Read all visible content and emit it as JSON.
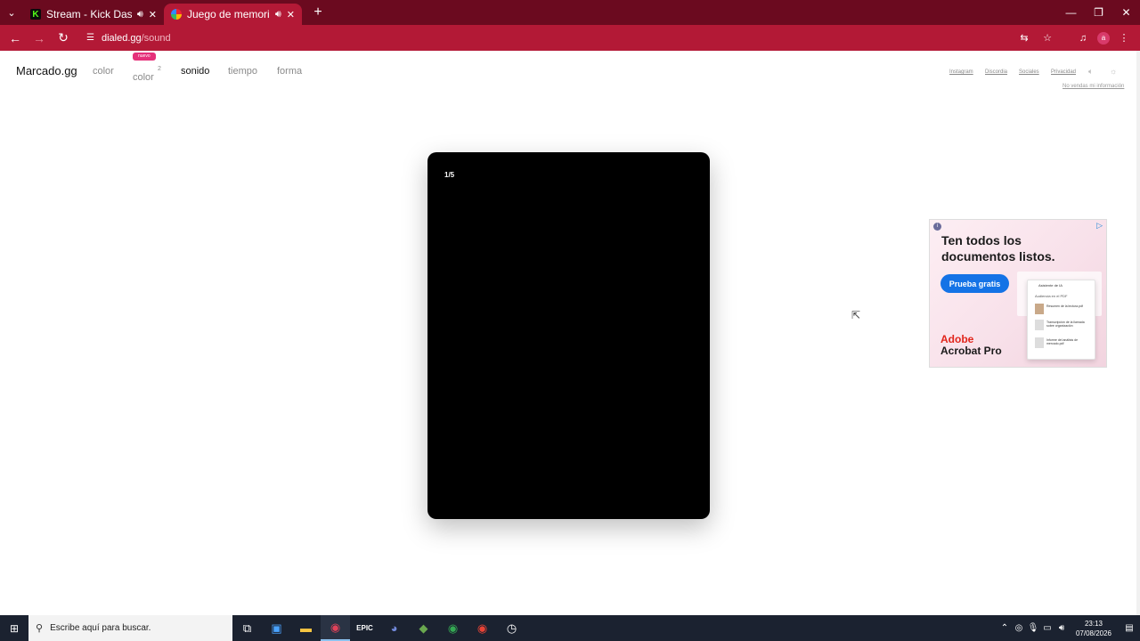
{
  "browser": {
    "tab_list_glyph": "⌄",
    "tabs": [
      {
        "title": "Stream - Kick Dashboard",
        "favicon_color": "#53fc18",
        "active": false
      },
      {
        "title": "Juego de memoria auditiva",
        "favicon_color": "#e8a33b",
        "active": true
      }
    ],
    "new_tab_glyph": "+",
    "window_controls": {
      "minimize": "—",
      "maximize": "❐",
      "close": "✕"
    },
    "url_host": "dialed.gg",
    "url_path": "/sound",
    "profile_initial": "a"
  },
  "site": {
    "brand": "Marcado.gg",
    "nav": [
      {
        "label": "color",
        "current": false
      },
      {
        "label": "color",
        "current": false
      },
      {
        "label": "sonido",
        "current": true
      },
      {
        "label": "tiempo",
        "current": false
      },
      {
        "label": "forma",
        "current": false
      }
    ],
    "new_badge": "nuevo",
    "superscript": "2",
    "right_links": [
      "Instagram",
      "Discordia",
      "Sociales",
      "Privacidad"
    ],
    "sell_info": "No vendas mi información"
  },
  "game": {
    "counter": "1/5"
  },
  "ad": {
    "headline": "Ten todos los documentos listos.",
    "cta": "Prueba gratis",
    "brand_line1": "Adobe",
    "brand_line2": "Acrobat Pro",
    "panel_title": "Asistente de IA",
    "panel_subtitle": "Audiencia en el PDF",
    "panel_rows": [
      "Resumen de la lectura.pdf",
      "Transcripción de la llamada sobre organización",
      "Informe del análisis de mercado.pdf"
    ]
  },
  "taskbar": {
    "search_placeholder": "Escribe aquí para buscar.",
    "time": "23:13",
    "date": "07/08/2026"
  },
  "colors": {
    "tabbar": "#6b0a1f",
    "toolbar": "#b31936",
    "new_badge": "#e5317a",
    "ad_button": "#1473e6"
  }
}
